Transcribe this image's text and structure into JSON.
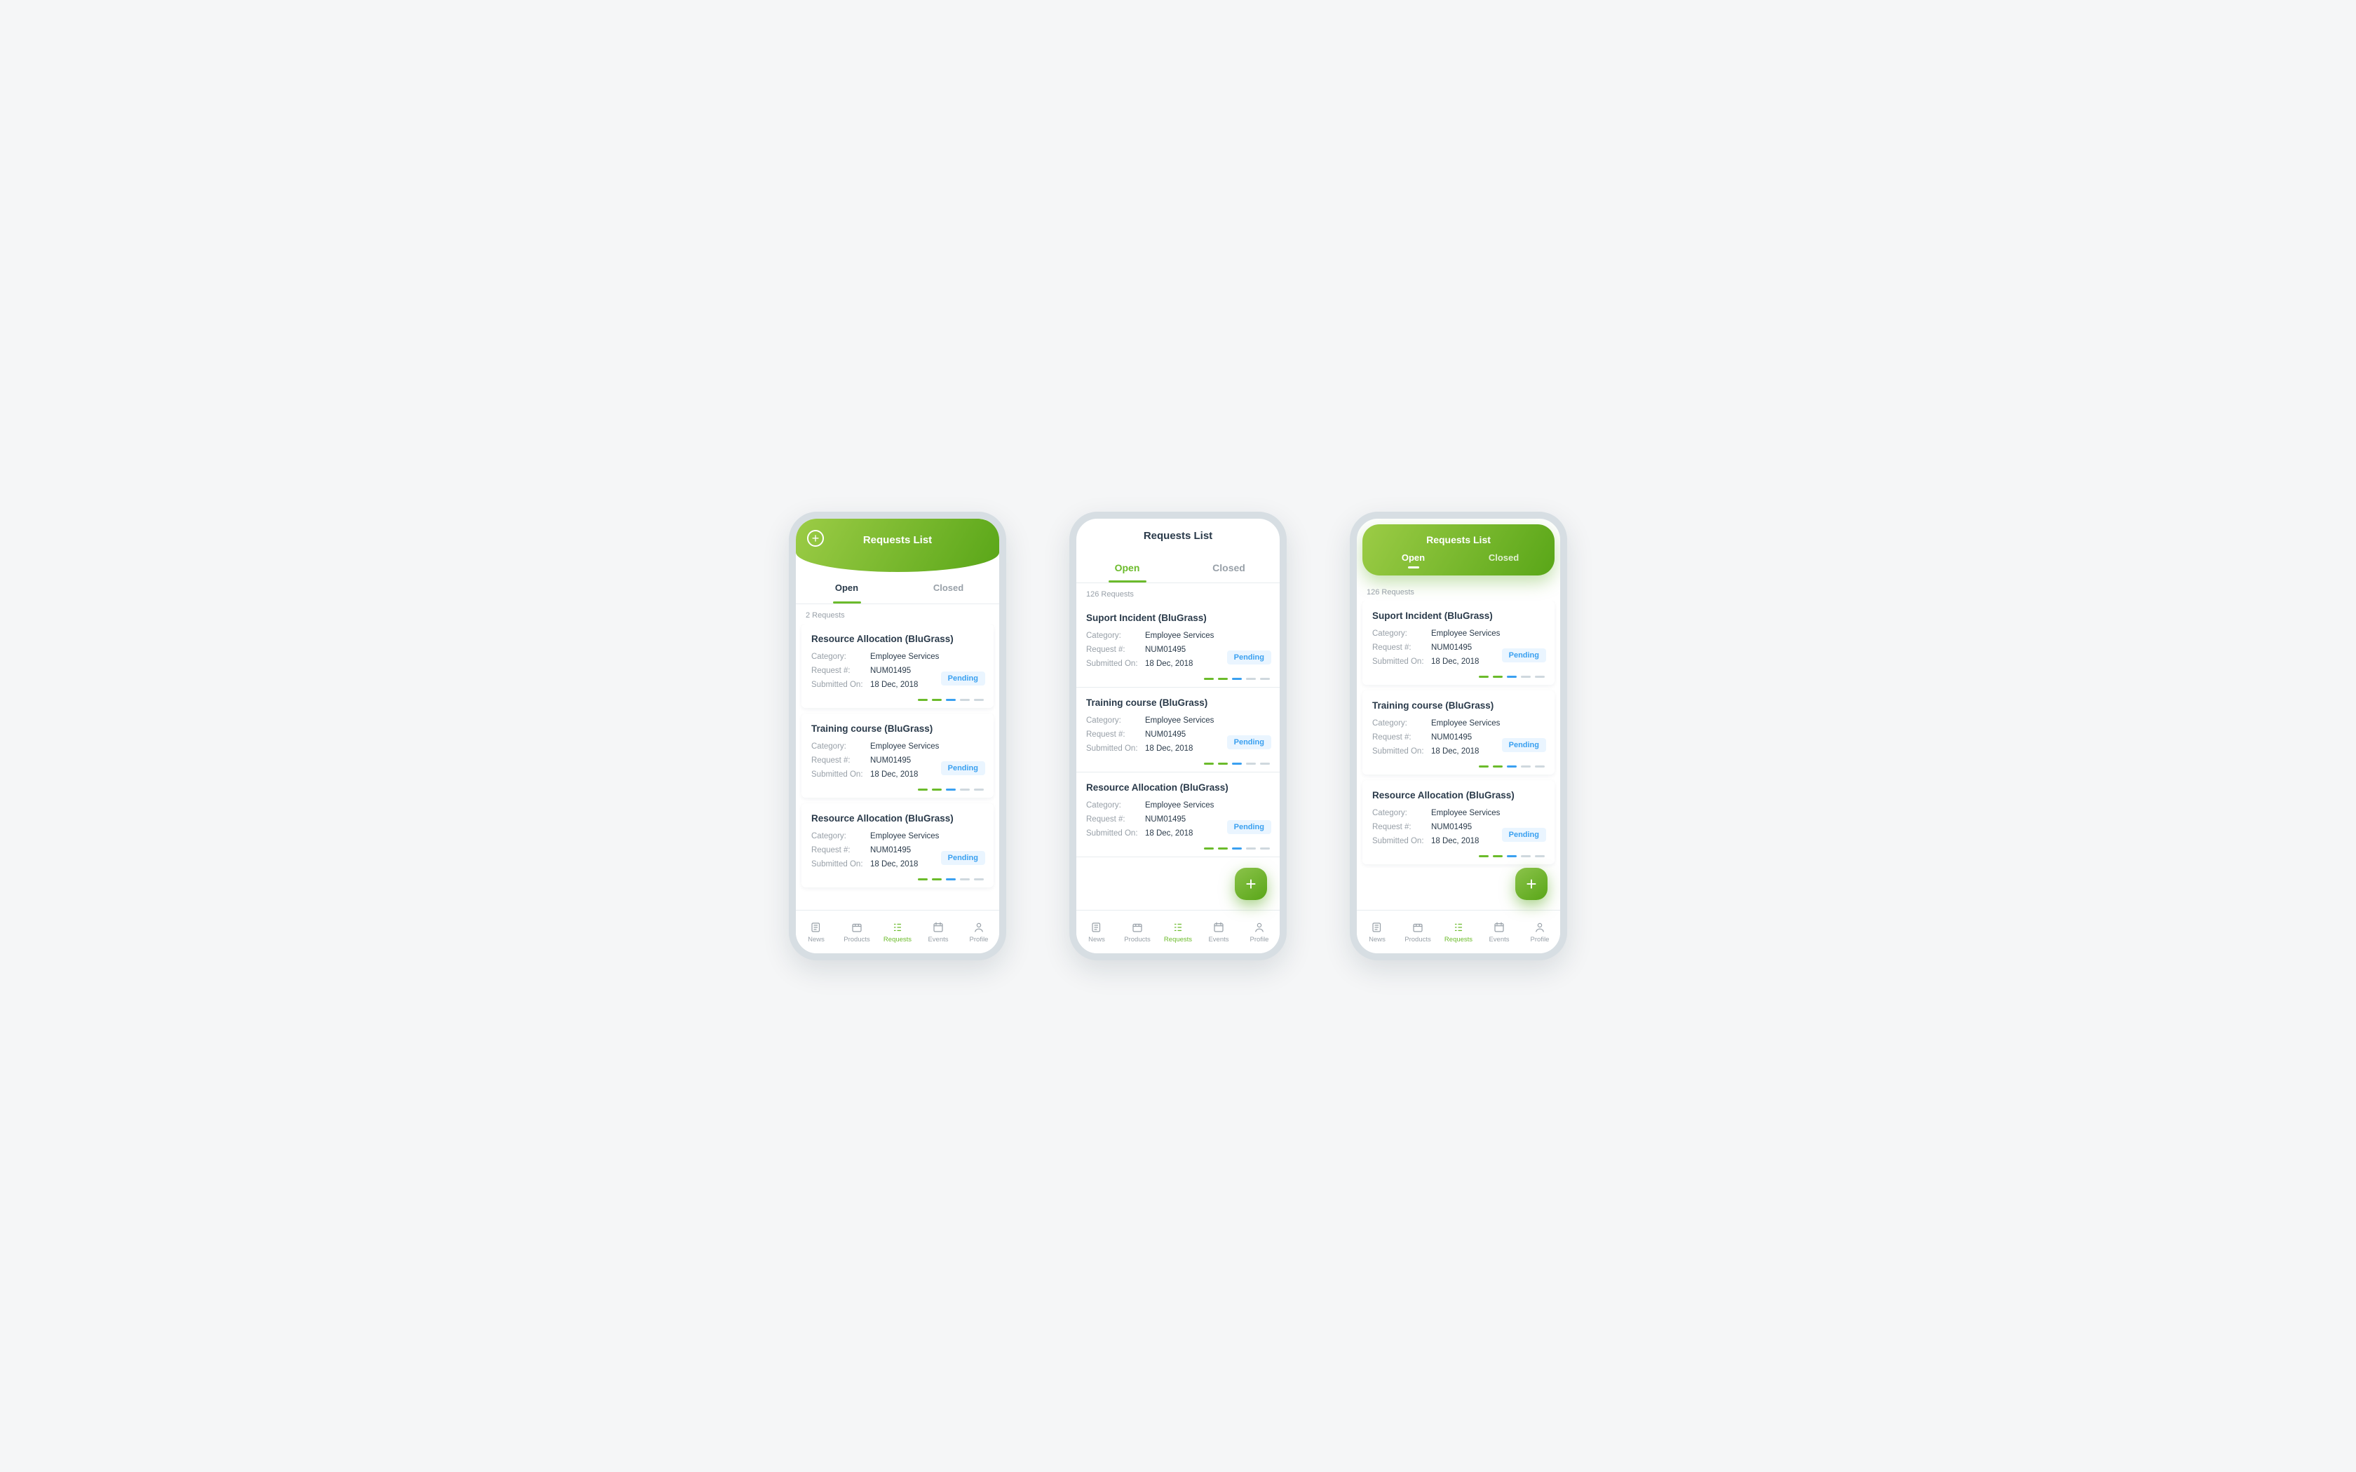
{
  "colors": {
    "accent": "#6bbb2b",
    "pill_bg": "#eaf5ff",
    "pill_fg": "#3aa0f0"
  },
  "labels": {
    "category": "Category:",
    "request_no": "Request #:",
    "submitted_on": "Submitted On:"
  },
  "nav": [
    {
      "label": "News",
      "icon": "news"
    },
    {
      "label": "Products",
      "icon": "products"
    },
    {
      "label": "Requests",
      "icon": "requests",
      "active": true
    },
    {
      "label": "Events",
      "icon": "events"
    },
    {
      "label": "Profile",
      "icon": "profile"
    }
  ],
  "screens": {
    "a": {
      "title": "Requests List",
      "tabs": [
        "Open",
        "Closed"
      ],
      "active_tab": 0,
      "count": "2 Requests",
      "add_in_header": true,
      "cards": [
        {
          "title": "Resource Allocation (BluGrass)",
          "category": "Employee Services",
          "req": "NUM01495",
          "date": "18 Dec, 2018",
          "status": "Pending"
        },
        {
          "title": "Training course (BluGrass)",
          "category": "Employee Services",
          "req": "NUM01495",
          "date": "18 Dec, 2018",
          "status": "Pending"
        },
        {
          "title": "Resource Allocation (BluGrass)",
          "category": "Employee Services",
          "req": "NUM01495",
          "date": "18 Dec, 2018",
          "status": "Pending"
        }
      ]
    },
    "b": {
      "title": "Requests List",
      "tabs": [
        "Open",
        "Closed"
      ],
      "active_tab": 0,
      "count": "126 Requests",
      "fab": true,
      "cards": [
        {
          "title": "Suport Incident (BluGrass)",
          "category": "Employee Services",
          "req": "NUM01495",
          "date": "18 Dec, 2018",
          "status": "Pending"
        },
        {
          "title": "Training course (BluGrass)",
          "category": "Employee Services",
          "req": "NUM01495",
          "date": "18 Dec, 2018",
          "status": "Pending"
        },
        {
          "title": "Resource Allocation (BluGrass)",
          "category": "Employee Services",
          "req": "NUM01495",
          "date": "18 Dec, 2018",
          "status": "Pending"
        }
      ]
    },
    "c": {
      "title": "Requests List",
      "tabs": [
        "Open",
        "Closed"
      ],
      "active_tab": 0,
      "count": "126 Requests",
      "fab": true,
      "cards": [
        {
          "title": "Suport Incident (BluGrass)",
          "category": "Employee Services",
          "req": "NUM01495",
          "date": "18 Dec, 2018",
          "status": "Pending"
        },
        {
          "title": "Training course (BluGrass)",
          "category": "Employee Services",
          "req": "NUM01495",
          "date": "18 Dec, 2018",
          "status": "Pending"
        },
        {
          "title": "Resource Allocation (BluGrass)",
          "category": "Employee Services",
          "req": "NUM01495",
          "date": "18 Dec, 2018",
          "status": "Pending"
        }
      ]
    }
  }
}
